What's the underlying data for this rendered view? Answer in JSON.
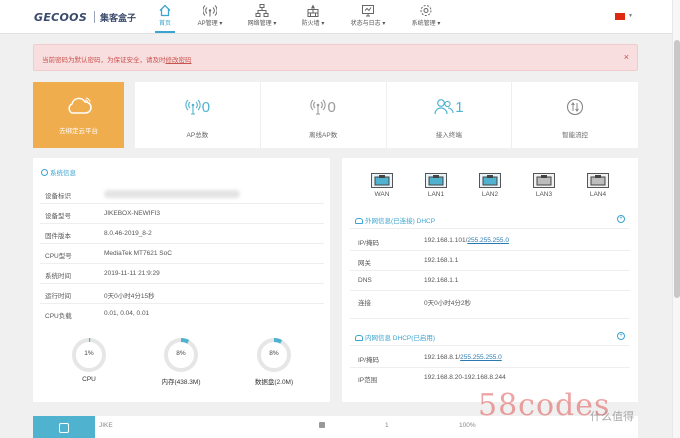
{
  "brand": {
    "logo_text": "GECOOS",
    "product": "集客盒子"
  },
  "nav": [
    {
      "label": "首页",
      "icon": "home-icon",
      "active": true
    },
    {
      "label": "AP管理 ▾",
      "icon": "wireless-icon",
      "active": false
    },
    {
      "label": "网络管理 ▾",
      "icon": "network-icon",
      "active": false
    },
    {
      "label": "防火墙 ▾",
      "icon": "firewall-icon",
      "active": false
    },
    {
      "label": "状态与日志 ▾",
      "icon": "status-log-icon",
      "active": false
    },
    {
      "label": "系统管理 ▾",
      "icon": "gear-icon",
      "active": false
    }
  ],
  "alert": {
    "text": "当前密码为默认密码，为保证安全，请及时",
    "link": "修改密码",
    "close": "×"
  },
  "cloud": {
    "label": "去绑定云平台",
    "color": "#f0ad4e"
  },
  "stats": [
    {
      "value": "0",
      "label": "AP总数",
      "icon": "ap-icon"
    },
    {
      "value": "0",
      "label": "离线AP数",
      "icon": "ap-offline-icon"
    },
    {
      "value": "1",
      "label": "接入终端",
      "icon": "users-icon"
    },
    {
      "value": "",
      "label": "智能流控",
      "icon": "flow-control-icon"
    }
  ],
  "system": {
    "title": "系统信息",
    "rows": [
      {
        "key": "设备标识",
        "value": ""
      },
      {
        "key": "设备型号",
        "value": "JIKEBOX-NEWIFI3"
      },
      {
        "key": "固件版本",
        "value": "8.0.46-2019_8-2"
      },
      {
        "key": "CPU型号",
        "value": "MediaTek MT7621 SoC"
      },
      {
        "key": "系统时间",
        "value": "2019-11-11 21:9:29"
      },
      {
        "key": "运行时间",
        "value": "0天0小时4分15秒"
      },
      {
        "key": "CPU负载",
        "value": "0.01, 0.04, 0.01"
      }
    ],
    "gauges": [
      {
        "value": "1%",
        "label": "CPU",
        "percent": 1
      },
      {
        "value": "8%",
        "label": "内存(438.3M)",
        "percent": 8
      },
      {
        "value": "8%",
        "label": "数据盘(2.0M)",
        "percent": 8
      }
    ]
  },
  "ports": [
    {
      "label": "WAN",
      "connected": true
    },
    {
      "label": "LAN1",
      "connected": true
    },
    {
      "label": "LAN2",
      "connected": true
    },
    {
      "label": "LAN3",
      "connected": false
    },
    {
      "label": "LAN4",
      "connected": false
    }
  ],
  "wan": {
    "title": "外网信息(已连接) DHCP",
    "rows": [
      {
        "key": "IP/掩码",
        "ip": "192.168.1.101/",
        "mask": "255.255.255.0"
      },
      {
        "key": "网关",
        "value": "192.168.1.1"
      },
      {
        "key": "DNS",
        "value": "192.168.1.1"
      },
      {
        "key": "连接",
        "value": "0天0小时4分2秒"
      }
    ]
  },
  "lan": {
    "title": "内网信息 DHCP(已启用)",
    "rows": [
      {
        "key": "IP/掩码",
        "ip": "192.168.8.1/",
        "mask": "255.255.255.0"
      },
      {
        "key": "IP范围",
        "value": "192.168.8.20-192.168.8.244"
      }
    ]
  },
  "bottom": {
    "name": "JIKE",
    "count": "1",
    "percent": "100%"
  },
  "colors": {
    "accent": "#3aa3d0",
    "cyan": "#4fb3cf",
    "orange": "#f0ad4e",
    "alert_text": "#c9534f"
  },
  "watermark": {
    "main": "58codes",
    "sub": "什么值得"
  }
}
